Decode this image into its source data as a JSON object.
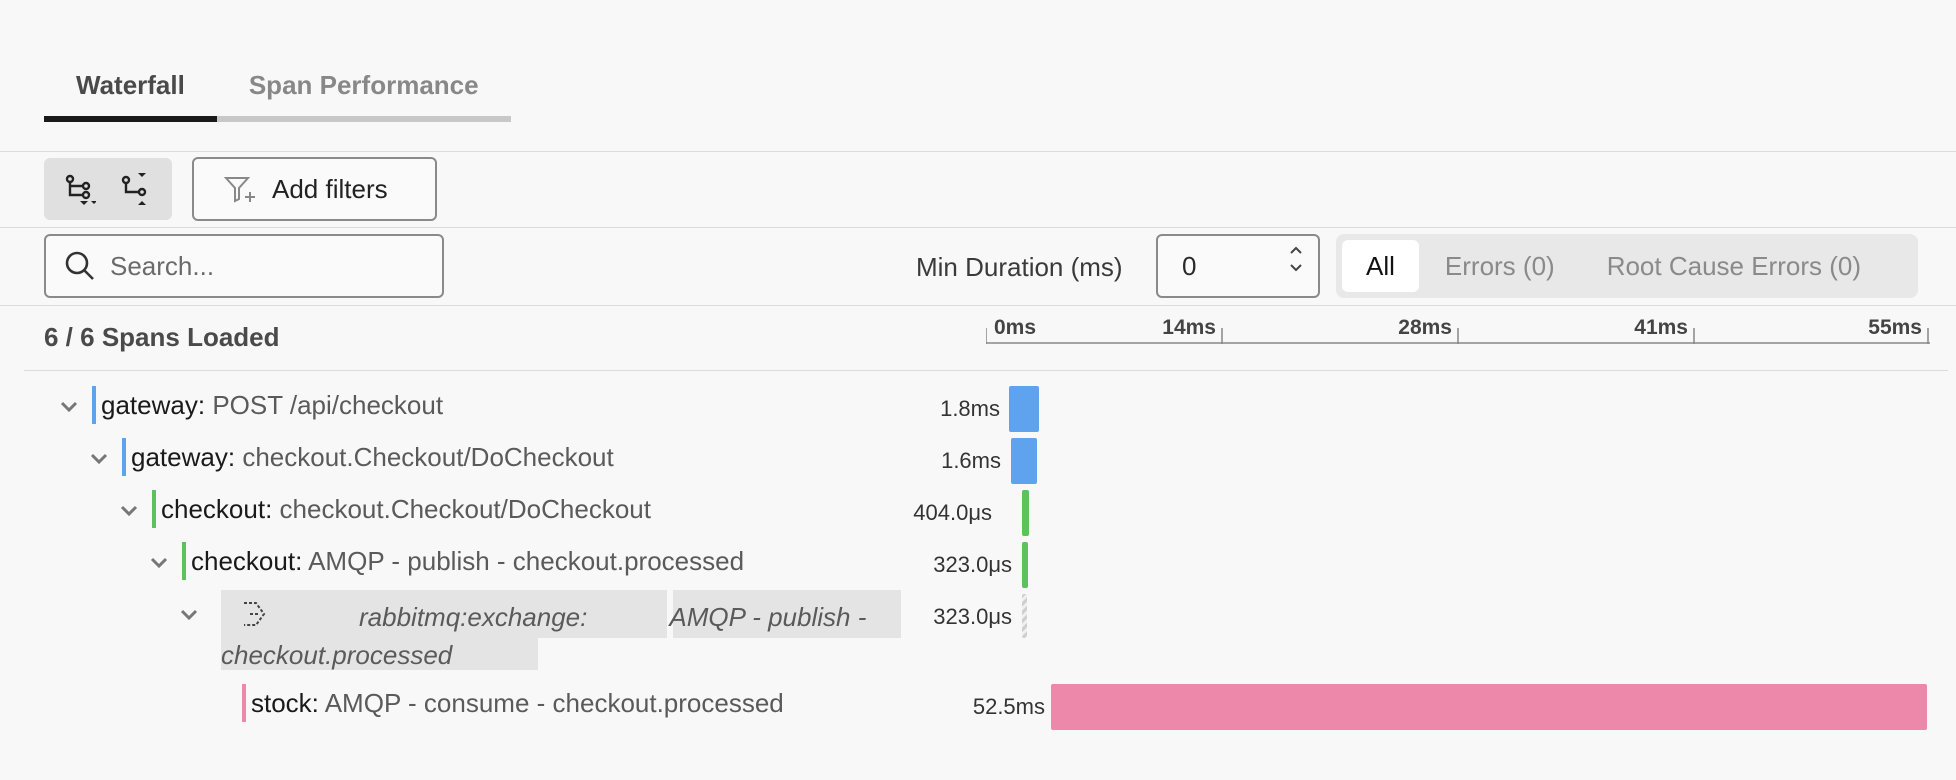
{
  "tabs": [
    {
      "label": "Waterfall",
      "active": true
    },
    {
      "label": "Span Performance",
      "active": false
    }
  ],
  "toolbar": {
    "expand_icon": "expand-all-icon",
    "collapse_icon": "collapse-all-icon",
    "add_filters_label": "Add filters",
    "filter_icon": "filter-plus-icon"
  },
  "search": {
    "placeholder": "Search..."
  },
  "min_duration": {
    "label": "Min Duration (ms)",
    "value": "0"
  },
  "error_filter": {
    "options": [
      "All",
      "Errors (0)",
      "Root Cause Errors (0)"
    ],
    "selected": "All"
  },
  "spans_loaded": "6 / 6 Spans Loaded",
  "timeline_axis": {
    "ticks": [
      "0ms",
      "14ms",
      "28ms",
      "41ms",
      "55ms"
    ],
    "max_ms": 55
  },
  "colors": {
    "gateway": "#5fa3ee",
    "checkout": "#5cc35c",
    "stock": "#ee88aa",
    "inferred": "#c8c8c8"
  },
  "spans": [
    {
      "service": "gateway:",
      "operation": "POST /api/checkout",
      "duration": "1.8ms",
      "depth": 0,
      "start_ms": 0.0,
      "dur_ms": 1.8,
      "color": "gateway"
    },
    {
      "service": "gateway:",
      "operation": "checkout.Checkout/DoCheckout",
      "duration": "1.6ms",
      "depth": 1,
      "start_ms": 0.1,
      "dur_ms": 1.6,
      "color": "gateway"
    },
    {
      "service": "checkout:",
      "operation": "checkout.Checkout/DoCheckout",
      "duration": "404.0μs",
      "depth": 2,
      "start_ms": 0.8,
      "dur_ms": 0.404,
      "color": "checkout"
    },
    {
      "service": "checkout:",
      "operation": "AMQP - publish - checkout.processed",
      "duration": "323.0μs",
      "depth": 3,
      "start_ms": 0.8,
      "dur_ms": 0.323,
      "color": "checkout"
    },
    {
      "service": "rabbitmq:exchange:",
      "operation": "AMQP - publish - checkout.processed",
      "duration": "323.0μs",
      "depth": 4,
      "start_ms": 0.8,
      "dur_ms": 0.323,
      "color": "inferred",
      "inferred": true,
      "icon": "inferred-service-icon"
    },
    {
      "service": "stock:",
      "operation": "AMQP - consume - checkout.processed",
      "duration": "52.5ms",
      "depth": 5,
      "start_ms": 2.5,
      "dur_ms": 52.5,
      "color": "stock"
    }
  ]
}
